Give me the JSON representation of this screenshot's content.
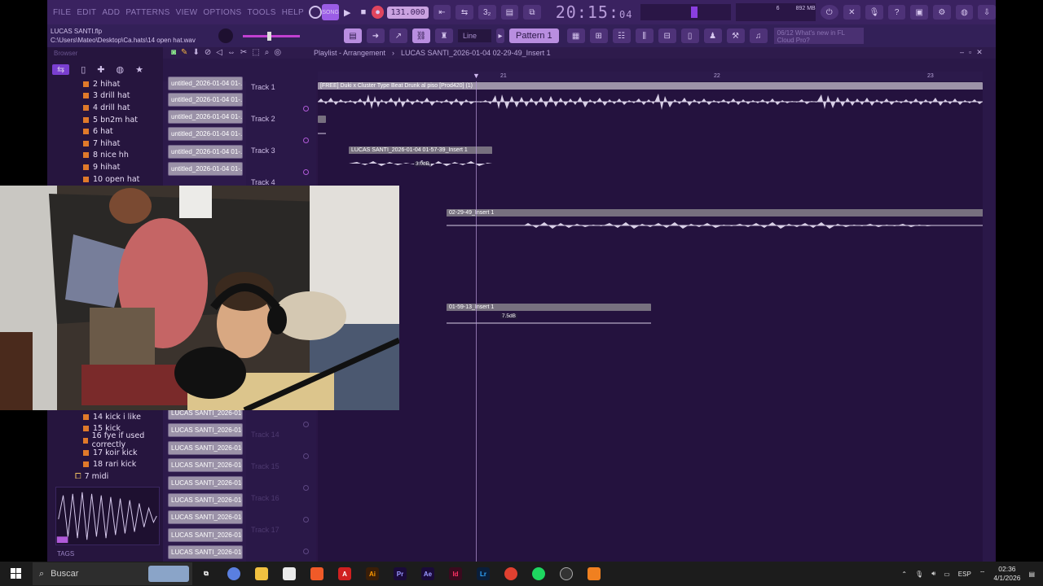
{
  "menu": [
    "FILE",
    "EDIT",
    "ADD",
    "PATTERNS",
    "VIEW",
    "OPTIONS",
    "TOOLS",
    "HELP"
  ],
  "transport": {
    "tempo": "131.000",
    "time": "20:15",
    "time_small": "04"
  },
  "cpu": {
    "memory": "892 MB",
    "polyphony": "6"
  },
  "file_info": {
    "project": "LUCAS SANTI.flp",
    "path": "C:\\Users\\Mateo\\Desktop\\Ca.hats\\14 open hat.wav"
  },
  "snap": "Line",
  "pattern": "Pattern 1",
  "news": {
    "line1": "06/12  What's new in FL",
    "line2": "Cloud Pro?"
  },
  "browser": {
    "header": "Browser",
    "items": [
      "2 hihat",
      "3 drill hat",
      "4 drill hat",
      "5 bn2m hat",
      "6 hat",
      "7 hihat",
      "8 nice hh",
      "9 hihat",
      "10 open hat"
    ],
    "items_lower": [
      "14 kick i like",
      "15 kick",
      "16 fye if used correctly",
      "17 koir kick",
      "18 rari kick"
    ],
    "folder": "7 midi",
    "tags": "TAGS"
  },
  "playlist": {
    "title_prefix": "Playlist - Arrangement",
    "title": "LUCAS SANTI_2026-01-04 02-29-49_Insert 1",
    "ruler": [
      "21",
      "22",
      "23"
    ],
    "tracks": [
      "Track 1",
      "Track 2",
      "Track 3",
      "Track 4"
    ],
    "dim_tracks": [
      "Track 14",
      "Track 15",
      "Track 16",
      "Track 17"
    ],
    "clip_thumbs_top": [
      "untitled_2026-01-04 01-..",
      "untitled_2026-01-04 01-..",
      "untitled_2026-01-04 01-..",
      "untitled_2026-01-04 01-..",
      "untitled_2026-01-04 01-..",
      "untitled_2026-01-04 01-.."
    ],
    "clip_thumbs_bottom": [
      "LUCAS SANTI_2026-01-04..",
      "LUCAS SANTI_2026-01-04..",
      "LUCAS SANTI_2026-01-04..",
      "LUCAS SANTI_2026-01-04..",
      "LUCAS SANTI_2026-01-04..",
      "LUCAS SANTI_2026-01-04..",
      "LUCAS SANTI_2026-01-04..",
      "LUCAS SANTI_2026-01-04..",
      "LUCAS SANTI_2026-01-04.."
    ],
    "clips": {
      "beat": "[FREE] Duki x Cluster Type Beat  Drunk al piso  [Prod420] (1)",
      "insert_a": "LUCAS SANTI_2026-01-04 01-57-39_Insert 1",
      "insert_a_gain": "3.0dB",
      "insert_b": "02-29-49_Insert 1",
      "insert_c": "01-59-13_Insert 1",
      "insert_c_gain": "7.5dB"
    }
  },
  "taskbar": {
    "search": "Buscar",
    "lang": "ESP",
    "time": "02:36",
    "date": "4/1/2026"
  },
  "colors": {
    "accent": "#9b5de5",
    "background": "#2a1646"
  }
}
